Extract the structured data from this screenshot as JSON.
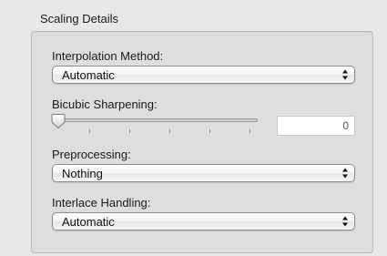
{
  "panel": {
    "title": "Scaling Details"
  },
  "interpolation": {
    "label": "Interpolation Method:",
    "value": "Automatic"
  },
  "sharpening": {
    "label": "Bicubic Sharpening:",
    "value": "0",
    "slider_level": 0
  },
  "preprocessing": {
    "label": "Preprocessing:",
    "value": "Nothing"
  },
  "interlace": {
    "label": "Interlace Handling:",
    "value": "Automatic"
  },
  "icons": {
    "popup_arrows": "up-down-arrows-icon",
    "slider_knob": "slider-knob-icon"
  }
}
